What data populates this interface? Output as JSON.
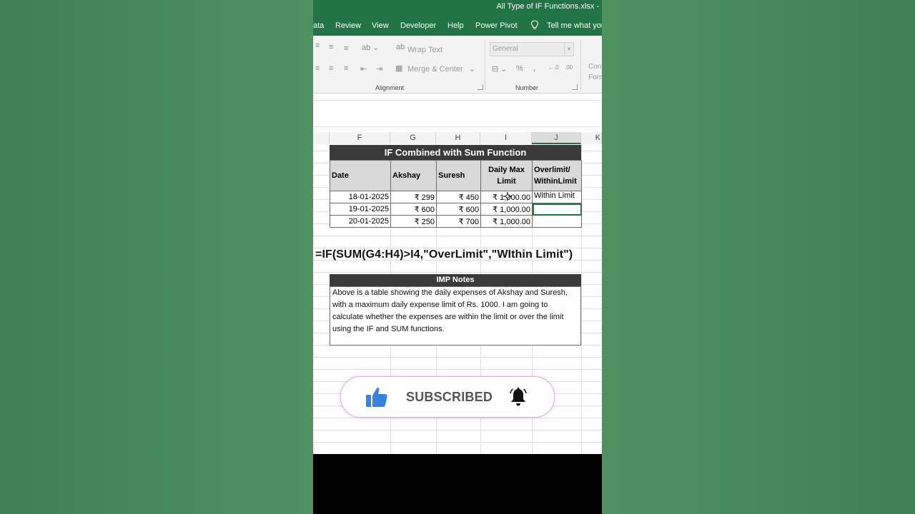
{
  "window": {
    "title": "All Type of IF Functions.xlsx  -"
  },
  "menu": {
    "items": [
      "ata",
      "Review",
      "View",
      "Developer",
      "Help",
      "Power Pivot"
    ],
    "tell_me": "Tell me what you"
  },
  "ribbon": {
    "wrap_text": "Wrap Text",
    "merge_center": "Merge & Center",
    "alignment_label": "Alignment",
    "number_format": "General",
    "number_label": "Number",
    "conditional_formatting": "Con\nForm"
  },
  "columns": [
    "F",
    "G",
    "H",
    "I",
    "J",
    "K"
  ],
  "table": {
    "title": "IF Combined with Sum Function",
    "headers": [
      "Date",
      "Akshay",
      "Suresh",
      "Daily Max Limit",
      "Overlimit/ WithinLimit"
    ],
    "rows": [
      [
        "18-01-2025",
        "₹ 299",
        "₹ 450",
        "₹ 1,000.00",
        "Within Limit"
      ],
      [
        "19-01-2025",
        "₹ 600",
        "₹ 600",
        "₹ 1,000.00",
        ""
      ],
      [
        "20-01-2025",
        "₹ 250",
        "₹ 700",
        "₹ 1,000.00",
        ""
      ]
    ]
  },
  "formula": "=IF(SUM(G4:H4)>I4,\"OverLimit\",\"WIthin Limit\")",
  "notes": {
    "title": "IMP Notes",
    "body": "Above is a table showing the daily expenses of Akshay and Suresh, with a maximum daily expense limit of Rs. 1000. I am going to calculate whether the expenses are within the limit or over the limit using the IF and SUM functions."
  },
  "subscribe": {
    "label": "SUBSCRIBED"
  },
  "colors": {
    "excel_green": "#217346",
    "header_dark": "#3a3a3a",
    "thumb_blue": "#3b82e0"
  }
}
